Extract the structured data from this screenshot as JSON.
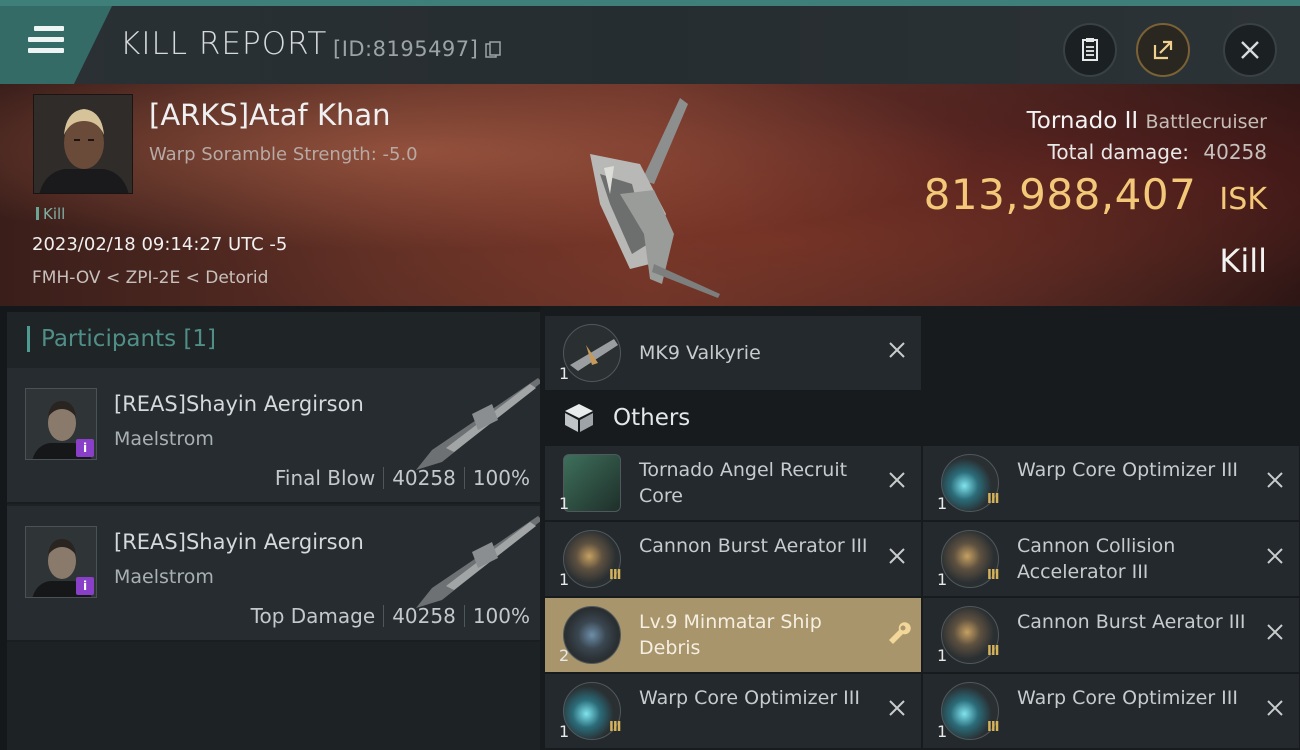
{
  "header": {
    "title": "KILL REPORT",
    "report_id": "[ID:8195497]",
    "icons": [
      "menu-icon",
      "copy-icon",
      "clipboard-icon",
      "share-icon",
      "close-icon"
    ]
  },
  "victim": {
    "name": "[ARKS]Ataf Khan",
    "subtitle": "Warp Soramble Strength: -5.0",
    "tag": "Kill",
    "datetime": "2023/02/18 09:14:27 UTC -5",
    "location": "FMH-OV < ZPI-2E < Detorid",
    "ship_name": "Tornado II",
    "ship_class": "Battlecruiser",
    "total_damage_label": "Total damage:",
    "total_damage": "40258",
    "isk_value": "813,988,407",
    "isk_unit": "ISK",
    "result": "Kill"
  },
  "participants": {
    "label": "Participants [1]",
    "items": [
      {
        "name": "[REAS]Shayin Aergirson",
        "ship": "Maelstrom",
        "role": "Final Blow",
        "damage": "40258",
        "percent": "100%",
        "badge": "i"
      },
      {
        "name": "[REAS]Shayin Aergirson",
        "ship": "Maelstrom",
        "role": "Top Damage",
        "damage": "40258",
        "percent": "100%",
        "badge": "i"
      }
    ]
  },
  "drone": {
    "qty": "1",
    "name": "MK9  Valkyrie"
  },
  "others_label": "Others",
  "items": [
    {
      "qty": "1",
      "name": "Tornado Angel Recruit Core",
      "meta": "",
      "highlight": false
    },
    {
      "qty": "1",
      "name": "Warp Core Optimizer III",
      "meta": "III",
      "highlight": false
    },
    {
      "qty": "1",
      "name": "Cannon Burst Aerator III",
      "meta": "III",
      "highlight": false
    },
    {
      "qty": "1",
      "name": "Cannon Collision Accelerator III",
      "meta": "III",
      "highlight": false
    },
    {
      "qty": "2",
      "name": "Lv.9 Minmatar Ship Debris",
      "meta": "",
      "highlight": true
    },
    {
      "qty": "1",
      "name": "Cannon Burst Aerator III",
      "meta": "III",
      "highlight": false
    },
    {
      "qty": "1",
      "name": "Warp Core Optimizer III",
      "meta": "III",
      "highlight": false
    },
    {
      "qty": "1",
      "name": "Warp Core Optimizer III",
      "meta": "III",
      "highlight": false
    }
  ],
  "colors": {
    "accent": "#3f7f79",
    "isk": "#f3c878",
    "highlight": "#a8956b",
    "badge": "#8a3fc8"
  }
}
